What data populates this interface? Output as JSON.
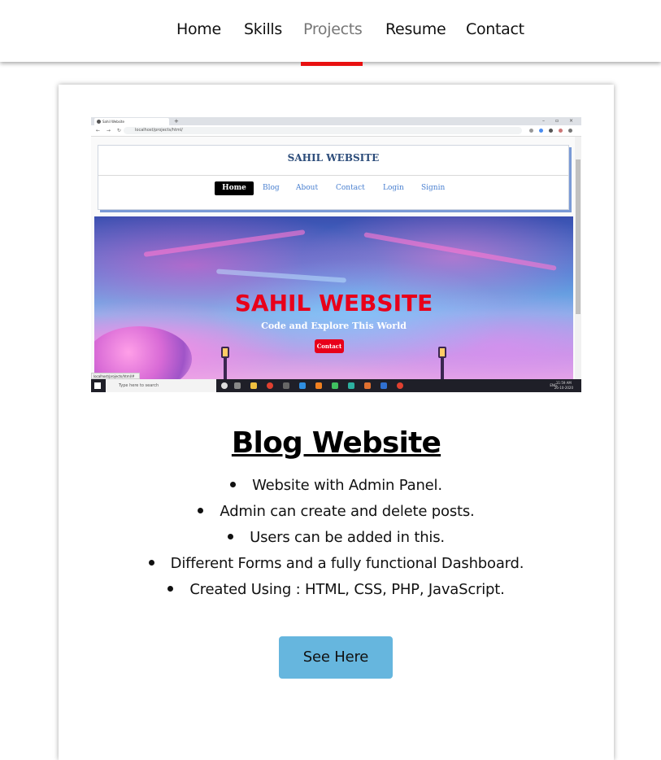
{
  "nav": {
    "items": [
      {
        "label": "Home",
        "active": false
      },
      {
        "label": "Skills",
        "active": false
      },
      {
        "label": "Projects",
        "active": true
      },
      {
        "label": "Resume",
        "active": false
      },
      {
        "label": "Contact",
        "active": false
      }
    ],
    "active_indicator_color": "#e81010"
  },
  "project": {
    "screenshot": {
      "browser_tab_title": "Sahil Website",
      "address_url": "localhost/projects/html/",
      "site_title": "SAHIL WEBSITE",
      "site_nav": [
        "Home",
        "Blog",
        "About",
        "Contact",
        "Login",
        "Signin"
      ],
      "hero_title": "SAHIL WEBSITE",
      "hero_subtitle": "Code and Explore This World",
      "hero_button": "Contact",
      "status_url": "localhost/projects/html/#",
      "taskbar_search": "Type here to search",
      "taskbar_lang": "ENG",
      "taskbar_time": "11:59 AM",
      "taskbar_date": "26-10-2020"
    },
    "title": "Blog Website",
    "features": [
      "Website with Admin Panel.",
      "Admin can create and delete posts.",
      "Users can be added in this.",
      "Different Forms and a fully functional Dashboard.",
      "Created Using : HTML, CSS, PHP, JavaScript."
    ],
    "button_label": "See Here",
    "button_color": "#66b6de"
  }
}
